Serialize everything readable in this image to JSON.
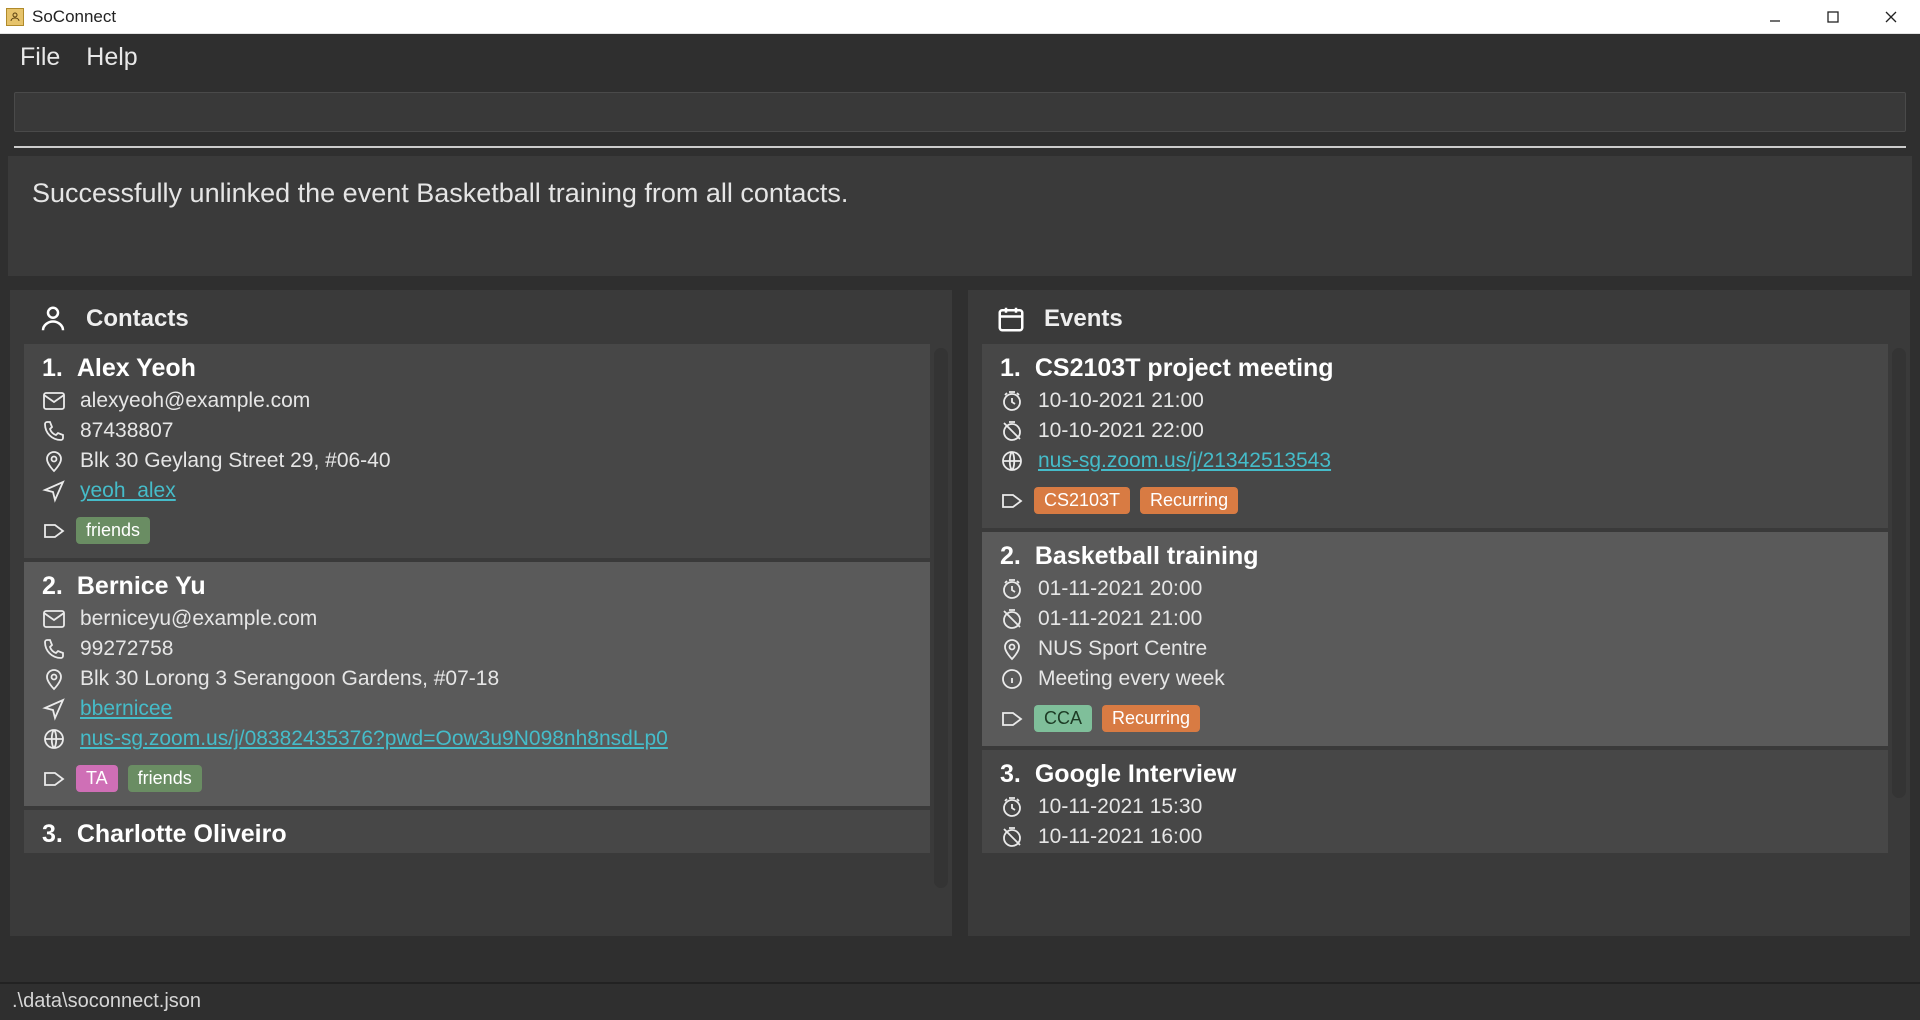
{
  "window": {
    "title": "SoConnect"
  },
  "menu": {
    "file": "File",
    "help": "Help"
  },
  "status_message": "Successfully unlinked the event Basketball training from all contacts.",
  "contacts_header": "Contacts",
  "events_header": "Events",
  "contacts": [
    {
      "idx": "1.",
      "name": "Alex Yeoh",
      "email": "alexyeoh@example.com",
      "phone": "87438807",
      "address": "Blk 30 Geylang Street 29, #06-40",
      "telegram": "yeoh_alex",
      "tags": [
        {
          "label": "friends",
          "color": "green"
        }
      ]
    },
    {
      "idx": "2.",
      "name": "Bernice Yu",
      "email": "berniceyu@example.com",
      "phone": "99272758",
      "address": "Blk 30 Lorong 3 Serangoon Gardens, #07-18",
      "telegram": "bbernicee",
      "zoom": "nus-sg.zoom.us/j/08382435376?pwd=Oow3u9N098nh8nsdLp0",
      "tags": [
        {
          "label": "TA",
          "color": "pink"
        },
        {
          "label": "friends",
          "color": "green"
        }
      ]
    },
    {
      "idx": "3.",
      "name": "Charlotte Oliveiro"
    }
  ],
  "events": [
    {
      "idx": "1.",
      "name": "CS2103T project meeting",
      "start": "10-10-2021 21:00",
      "end": "10-10-2021 22:00",
      "link": "nus-sg.zoom.us/j/21342513543",
      "tags": [
        {
          "label": "CS2103T",
          "color": "orange"
        },
        {
          "label": "Recurring",
          "color": "orange"
        }
      ]
    },
    {
      "idx": "2.",
      "name": "Basketball training",
      "start": "01-11-2021 20:00",
      "end": "01-11-2021 21:00",
      "location": "NUS Sport Centre",
      "note": "Meeting every week",
      "tags": [
        {
          "label": "CCA",
          "color": "teal"
        },
        {
          "label": "Recurring",
          "color": "orange"
        }
      ]
    },
    {
      "idx": "3.",
      "name": "Google Interview",
      "start": "10-11-2021 15:30",
      "end": "10-11-2021 16:00"
    }
  ],
  "footer_path": ".\\data\\soconnect.json"
}
